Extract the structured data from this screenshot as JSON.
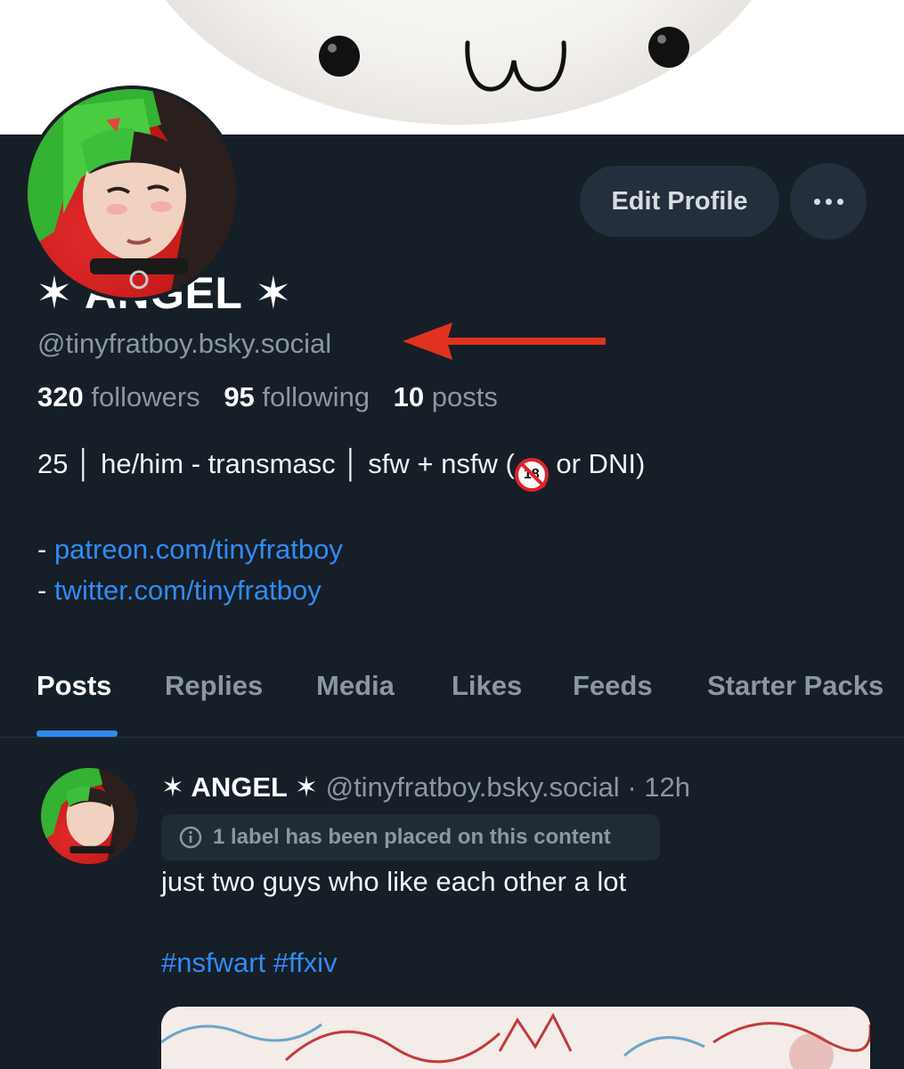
{
  "profile": {
    "display_name": "✶ ANGEL ✶",
    "handle": "@tinyfratboy.bsky.social",
    "edit_button": "Edit Profile",
    "stats": {
      "followers_count": "320",
      "followers_label": "followers",
      "following_count": "95",
      "following_label": "following",
      "posts_count": "10",
      "posts_label": "posts"
    },
    "bio": {
      "line1_a": "25 │ he/him - transmasc │ sfw + nsfw (",
      "no18_icon": "no-under-18-icon",
      "line1_b": " or DNI)",
      "link1_prefix": "- ",
      "link1": "patreon.com/tinyfratboy",
      "link2_prefix": "- ",
      "link2": "twitter.com/tinyfratboy"
    }
  },
  "tabs": [
    {
      "label": "Posts",
      "active": true
    },
    {
      "label": "Replies"
    },
    {
      "label": "Media"
    },
    {
      "label": "Likes"
    },
    {
      "label": "Feeds"
    },
    {
      "label": "Starter Packs"
    }
  ],
  "post": {
    "author_name": "✶ ANGEL ✶",
    "author_handle": "@tinyfratboy.bsky.social",
    "separator": " · ",
    "time": "12h",
    "label_notice": "1 label has been placed on this content",
    "text": "just two guys who like each other a lot",
    "tags": "#nsfwart #ffxiv"
  },
  "colors": {
    "background": "#161e27",
    "accent": "#2f8cf6",
    "annotation_arrow": "#e0321f",
    "muted_text": "#8b97a4"
  }
}
